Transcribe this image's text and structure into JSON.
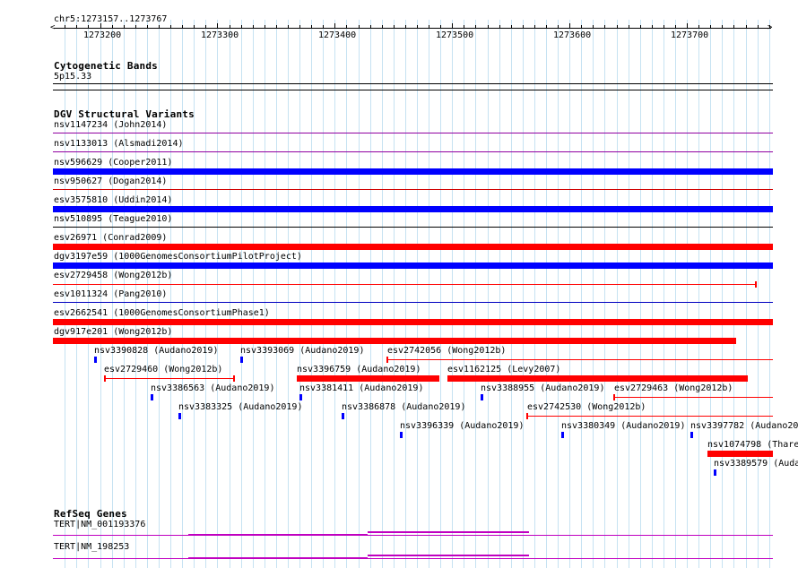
{
  "ruler": {
    "position_label": "chr5:1273157..1273767",
    "ticks": [
      "1273200",
      "1273300",
      "1273400",
      "1273500",
      "1273600",
      "1273700"
    ]
  },
  "cytoband": {
    "title": "Cytogenetic Bands",
    "band": "5p15.33"
  },
  "dgv": {
    "title": "DGV Structural Variants",
    "rows": [
      "nsv1147234 (John2014)",
      "nsv1133013 (Alsmadi2014)",
      "nsv596629 (Cooper2011)",
      "nsv950627 (Dogan2014)",
      "esv3575810 (Uddin2014)",
      "nsv510895 (Teague2010)",
      "esv26971 (Conrad2009)",
      "dgv3197e59 (1000GenomesConsortiumPilotProject)",
      "esv2729458 (Wong2012b)",
      "esv1011324 (Pang2010)",
      "esv2662541 (1000GenomesConsortiumPhase1)",
      "dgv917e201 (Wong2012b)"
    ],
    "small": [
      "nsv3390828 (Audano2019)",
      "nsv3393069 (Audano2019)",
      "esv2742056 (Wong2012b)",
      "esv2729460 (Wong2012b)",
      "nsv3396759 (Audano2019)",
      "esv1162125 (Levy2007)",
      "nsv3386563 (Audano2019)",
      "nsv3381411 (Audano2019)",
      "nsv3388955 (Audano2019)",
      "esv2729463 (Wong2012b)",
      "nsv3383325 (Audano2019)",
      "nsv3386878 (Audano2019)",
      "esv2742530 (Wong2012b)",
      "nsv3396339 (Audano2019)",
      "nsv3380349 (Audano2019)",
      "nsv3397782 (Audano20",
      "nsv1074798 (Thare",
      "nsv3389579 (Auda"
    ]
  },
  "refseq": {
    "title": "RefSeq Genes",
    "genes": [
      "TERT|NM_001193376",
      "TERT|NM_198253"
    ]
  },
  "colors": {
    "grid": "#c6e2f2",
    "gain": "#0000ff",
    "loss": "#ff0000",
    "gene": "#c000c0"
  }
}
